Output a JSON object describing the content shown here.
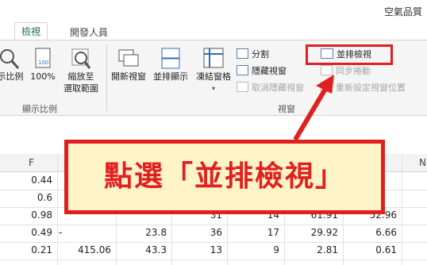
{
  "window": {
    "title": "空氣品質"
  },
  "tabs": [
    {
      "label": "檢視"
    },
    {
      "label": "開發人員"
    }
  ],
  "ribbon": {
    "zoom_group": {
      "label": "顯示比例",
      "buttons": [
        {
          "label": "示比例"
        },
        {
          "label": "100%"
        },
        {
          "label_line1": "縮放至",
          "label_line2": "選取範圍"
        }
      ]
    },
    "window_group": {
      "label": "視窗",
      "buttons": [
        {
          "label": "開新視窗"
        },
        {
          "label": "並排顯示"
        },
        {
          "label": "凍結窗格"
        }
      ],
      "small_items": [
        {
          "label": "分割"
        },
        {
          "label": "隱藏視窗"
        },
        {
          "label": "取消隱藏視窗"
        }
      ],
      "side_items": [
        {
          "label": "並排檢視"
        },
        {
          "label": "同步捲動"
        },
        {
          "label": "重新設定視窗位置"
        }
      ]
    }
  },
  "sheet": {
    "col_headers": [
      "F",
      "N"
    ],
    "rows": [
      [
        "0.44",
        "",
        "",
        "",
        "",
        "",
        ""
      ],
      [
        "0.6",
        "",
        "",
        "",
        "",
        "",
        ""
      ],
      [
        "0.98",
        "",
        "",
        "31",
        "14",
        "61.91",
        "52.96"
      ],
      [
        "0.49",
        "-",
        "23.8",
        "36",
        "17",
        "29.92",
        "6.66"
      ],
      [
        "0.21",
        "415.06",
        "43.3",
        "13",
        "9",
        "2.81",
        "0.61"
      ]
    ]
  },
  "callout": {
    "text": "點選「並排檢視」"
  },
  "colors": {
    "accent": "#e02020",
    "excel_green": "#217346"
  }
}
